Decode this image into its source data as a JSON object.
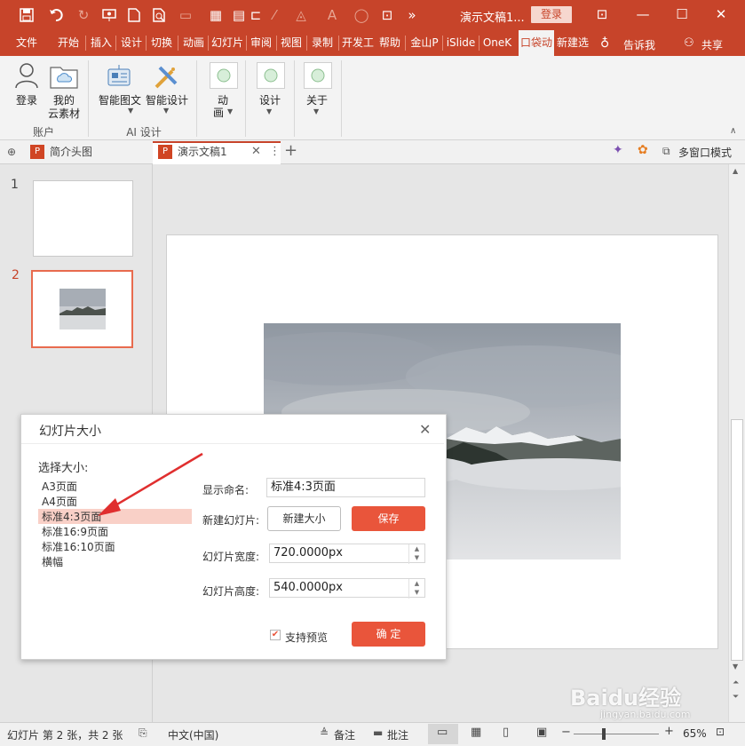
{
  "window": {
    "title": "演示文稿1...",
    "login_label": "登录",
    "share_label": "共享",
    "tell_me": "告诉我"
  },
  "ribbon_tabs": [
    "文件",
    "开始",
    "插入",
    "设计",
    "切换",
    "动画",
    "幻灯片",
    "审阅",
    "视图",
    "录制",
    "开发工",
    "帮助",
    "金山P",
    "iSlide",
    "OneK",
    "口袋动",
    "新建选"
  ],
  "ribbon_groups": {
    "account": {
      "label": "账户",
      "buttons": [
        "登录",
        "我的",
        "云素材"
      ]
    },
    "ai": {
      "label": "AI 设计",
      "buttons": [
        "智能图文",
        "智能设计"
      ]
    },
    "anim": {
      "label1": "动",
      "label2": "画"
    },
    "design": {
      "label": "设计"
    },
    "about": {
      "label": "关于"
    }
  },
  "doc_tabs": [
    "简介头图",
    "演示文稿1"
  ],
  "multiwindow_label": "多窗口模式",
  "thumbnails": [
    "1",
    "2"
  ],
  "dialog": {
    "title": "幻灯片大小",
    "choose_label": "选择大小:",
    "sizes": [
      "A3页面",
      "A4页面",
      "标准4:3页面",
      "标准16:9页面",
      "标准16:10页面",
      "横幅"
    ],
    "selected_index": 2,
    "name_label": "显示命名:",
    "name_value": "标准4:3页面",
    "new_slide_label": "新建幻灯片:",
    "new_size_button": "新建大小",
    "save_button": "保存",
    "width_label": "幻灯片宽度:",
    "width_value": "720.0000px",
    "height_label": "幻灯片高度:",
    "height_value": "540.0000px",
    "preview_label": "支持预览",
    "preview_checked": true,
    "ok_button": "确 定"
  },
  "status": {
    "slide_info": "幻灯片 第 2 张，共 2 张",
    "language": "中文(中国)",
    "notes": "备注",
    "comments": "批注",
    "zoom": "65%"
  },
  "watermark": {
    "text1": "Baidu经验",
    "text2": "jingyan.baidu.com"
  },
  "colors": {
    "accent": "#c7442a",
    "button": "#e9553b",
    "selection": "#f9d0c7"
  }
}
